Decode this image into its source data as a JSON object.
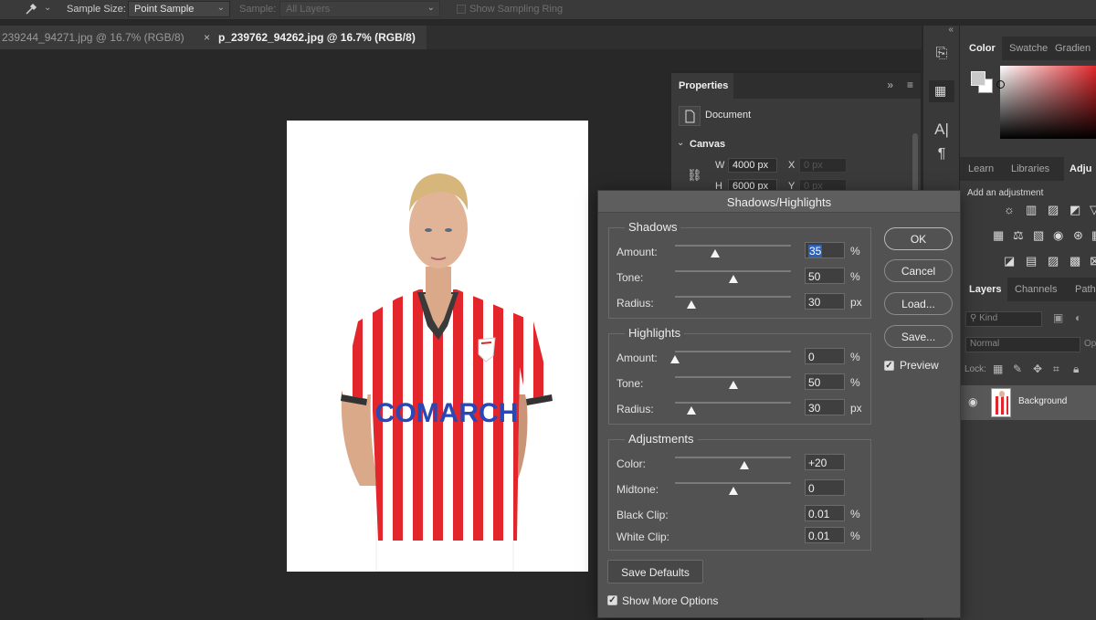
{
  "options_bar": {
    "tool_icon": "eyedropper-icon",
    "sample_size_label": "Sample Size:",
    "sample_size_value": "Point Sample",
    "sample_label": "Sample:",
    "sample_value": "All Layers",
    "sampling_ring_label": "Show Sampling Ring"
  },
  "doc_tabs": [
    {
      "label": "239244_94271.jpg @ 16.7% (RGB/8)"
    },
    {
      "label": "p_239762_94262.jpg @ 16.7% (RGB/8)",
      "close": "×"
    }
  ],
  "properties": {
    "title": "Properties",
    "document_label": "Document",
    "canvas_label": "Canvas",
    "w_label": "W",
    "w_value": "4000 px",
    "h_label": "H",
    "h_value": "6000 px",
    "x_label": "X",
    "x_placeholder": "0 px",
    "y_label": "Y",
    "y_placeholder": "0 px"
  },
  "right_panels": {
    "color_tabs": [
      "Color",
      "Swatche",
      "Gradien"
    ],
    "learn_tabs": [
      "Learn",
      "Libraries",
      "Adju"
    ],
    "add_adjustment": "Add an adjustment",
    "layers_tabs": [
      "Layers",
      "Channels",
      "Paths"
    ],
    "kind_placeholder": "Kind",
    "blend_mode": "Normal",
    "opacity_label": "Op",
    "lock_label": "Lock:",
    "layer_name": "Background"
  },
  "dialog": {
    "title": "Shadows/Highlights",
    "shadows": {
      "label": "Shadows",
      "rows": [
        {
          "label": "Amount:",
          "value": "35",
          "unit": "%",
          "level": 0.35
        },
        {
          "label": "Tone:",
          "value": "50",
          "unit": "%",
          "level": 0.5
        },
        {
          "label": "Radius:",
          "value": "30",
          "unit": "px",
          "level": 0.14
        }
      ]
    },
    "highlights": {
      "label": "Highlights",
      "rows": [
        {
          "label": "Amount:",
          "value": "0",
          "unit": "%",
          "level": 0.0
        },
        {
          "label": "Tone:",
          "value": "50",
          "unit": "%",
          "level": 0.5
        },
        {
          "label": "Radius:",
          "value": "30",
          "unit": "px",
          "level": 0.14
        }
      ]
    },
    "adjustments": {
      "label": "Adjustments",
      "rows": [
        {
          "label": "Color:",
          "value": "+20",
          "unit": "",
          "level": 0.6
        },
        {
          "label": "Midtone:",
          "value": "0",
          "unit": "",
          "level": 0.5
        },
        {
          "label": "Black Clip:",
          "value": "0.01",
          "unit": "%"
        },
        {
          "label": "White Clip:",
          "value": "0.01",
          "unit": "%"
        }
      ]
    },
    "buttons": {
      "ok": "OK",
      "cancel": "Cancel",
      "load": "Load...",
      "save": "Save...",
      "save_defaults": "Save Defaults"
    },
    "preview_label": "Preview",
    "preview_checked": true,
    "show_more_label": "Show More Options",
    "show_more_checked": true
  },
  "photo": {
    "sponsor_text": "COMARCH",
    "shirt_red": "#e3262b",
    "background": "#ffffff"
  }
}
